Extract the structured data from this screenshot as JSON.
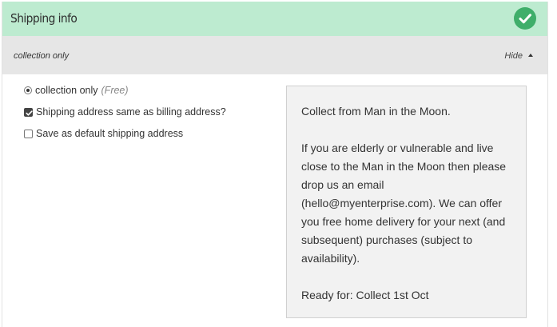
{
  "header": {
    "title": "Shipping info",
    "status_icon": "checkmark-icon",
    "status_color": "#3fae6a",
    "background": "#bdebd0"
  },
  "subbar": {
    "selected_method": "collection only",
    "toggle_label": "Hide",
    "toggle_icon": "caret-up-icon"
  },
  "options": {
    "method": {
      "label": "collection only",
      "price": "(Free)",
      "selected": true
    },
    "same_as_billing": {
      "label": "Shipping address same as billing address?",
      "checked": true
    },
    "save_default": {
      "label": "Save as default shipping address",
      "checked": false
    }
  },
  "info": {
    "line1": "Collect from Man in the Moon.",
    "line2": "If you are elderly or vulnerable and live close to the Man in the Moon then please drop us an email (hello@myenterprise.com).  We can offer you free home delivery for your next (and subsequent) purchases (subject to availability).",
    "line3": "Ready for: Collect 1st Oct"
  }
}
